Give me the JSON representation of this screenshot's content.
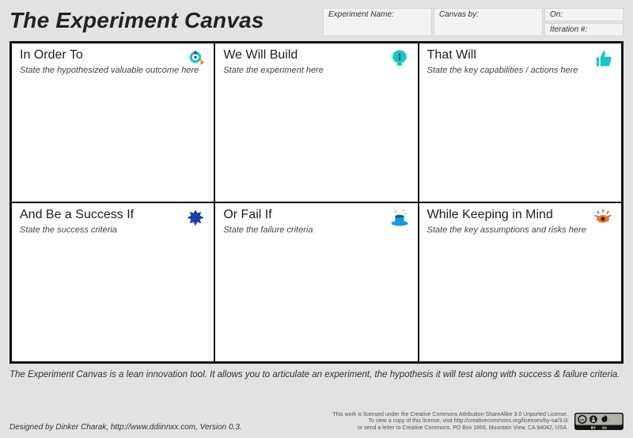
{
  "title": "The Experiment Canvas",
  "meta": {
    "experiment_name_label": "Experiment Name:",
    "canvas_by_label": "Canvas by:",
    "on_label": "On:",
    "iteration_label": "Iteration #:"
  },
  "cells": {
    "in_order_to": {
      "title": "In Order To",
      "sub": "State the hypothesized valuable outcome here"
    },
    "we_will_build": {
      "title": "We Will Build",
      "sub": "State the experiment here"
    },
    "that_will": {
      "title": "That Will",
      "sub": "State the key capabilities / actions here"
    },
    "success_if": {
      "title": "And Be a Success If",
      "sub": "State the success criteria"
    },
    "fail_if": {
      "title": "Or Fail If",
      "sub": "State the failure criteria"
    },
    "keeping_in_mind": {
      "title": "While Keeping in Mind",
      "sub": "State the key assumptions and risks here"
    }
  },
  "tagline": "The Experiment Canvas is a lean innovation tool. It allows you to articulate an experiment, the hypothesis it will test along with success & failure criteria.",
  "footer": {
    "designed": "Designed by Dinker Charak, http://www.ddiinnxx.com, Version 0.3.",
    "license_line1": "This work is licensed under the Creative Commons Attribution-ShareAlike 3.0 Unported License.",
    "license_line2": "To view a copy of this license, visit http://creativecommons.org/licenses/by-sa/3.0/",
    "license_line3": "or send a letter to Creative Commons, PO Box 1866, Mountain View, CA 94042, USA."
  },
  "colors": {
    "teal": "#1cc6c6",
    "blue": "#1a9bd8",
    "darkblue": "#1d3fa6",
    "orange": "#f07b2b"
  }
}
